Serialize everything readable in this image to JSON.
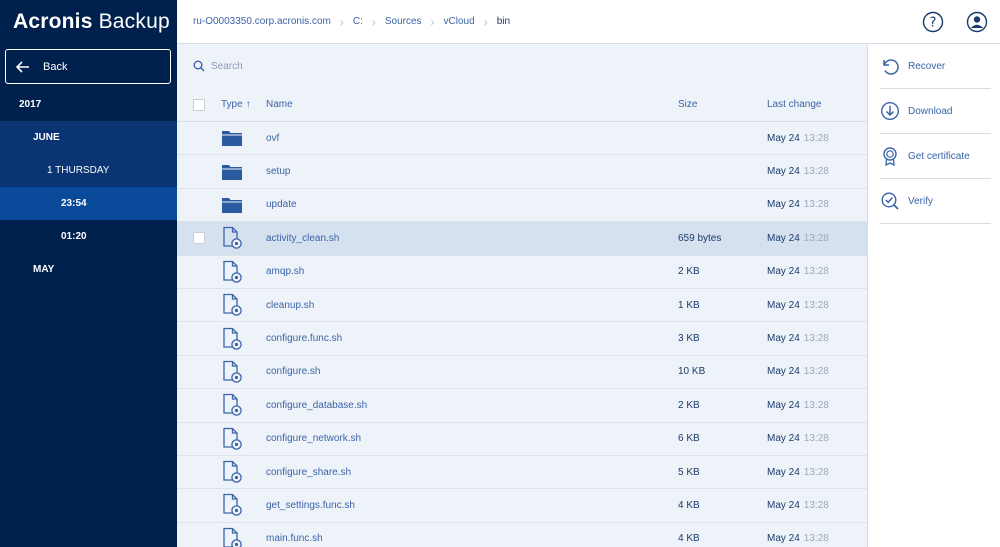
{
  "brand": {
    "name_bold": "Acronis",
    "name_light": "Backup"
  },
  "sidebar": {
    "back_label": "Back",
    "tree": [
      {
        "label": "2017",
        "level": 0,
        "state": "normal"
      },
      {
        "label": "JUNE",
        "level": 1,
        "state": "expanded"
      },
      {
        "label": "1 THURSDAY",
        "level": 2,
        "state": "expanded"
      },
      {
        "label": "23:54",
        "level": 3,
        "state": "selected"
      },
      {
        "label": "01:20",
        "level": 3,
        "state": "normal"
      },
      {
        "label": "MAY",
        "level": 1,
        "state": "normal"
      }
    ]
  },
  "breadcrumb": [
    "ru-O0003350.corp.acronis.com",
    "C:",
    "Sources",
    "vCloud",
    "bin"
  ],
  "topbar_icons": [
    "help-icon",
    "account-icon"
  ],
  "search": {
    "placeholder": "Search"
  },
  "table": {
    "headers": {
      "type": "Type",
      "name": "Name",
      "size": "Size",
      "last_change": "Last change"
    },
    "sort": {
      "column": "type",
      "direction": "ascending"
    },
    "rows": [
      {
        "kind": "folder",
        "name": "ovf",
        "size": "",
        "date": "May 24",
        "time": "13:28"
      },
      {
        "kind": "folder",
        "name": "setup",
        "size": "",
        "date": "May 24",
        "time": "13:28"
      },
      {
        "kind": "folder",
        "name": "update",
        "size": "",
        "date": "May 24",
        "time": "13:28"
      },
      {
        "kind": "file",
        "name": "activity_clean.sh",
        "size": "659 bytes",
        "date": "May 24",
        "time": "13:28",
        "selected": true
      },
      {
        "kind": "file",
        "name": "amqp.sh",
        "size": "2 KB",
        "date": "May 24",
        "time": "13:28"
      },
      {
        "kind": "file",
        "name": "cleanup.sh",
        "size": "1 KB",
        "date": "May 24",
        "time": "13:28"
      },
      {
        "kind": "file",
        "name": "configure.func.sh",
        "size": "3 KB",
        "date": "May 24",
        "time": "13:28"
      },
      {
        "kind": "file",
        "name": "configure.sh",
        "size": "10 KB",
        "date": "May 24",
        "time": "13:28"
      },
      {
        "kind": "file",
        "name": "configure_database.sh",
        "size": "2 KB",
        "date": "May 24",
        "time": "13:28"
      },
      {
        "kind": "file",
        "name": "configure_network.sh",
        "size": "6 KB",
        "date": "May 24",
        "time": "13:28"
      },
      {
        "kind": "file",
        "name": "configure_share.sh",
        "size": "5 KB",
        "date": "May 24",
        "time": "13:28"
      },
      {
        "kind": "file",
        "name": "get_settings.func.sh",
        "size": "4 KB",
        "date": "May 24",
        "time": "13:28"
      },
      {
        "kind": "file",
        "name": "main.func.sh",
        "size": "4 KB",
        "date": "May 24",
        "time": "13:28"
      }
    ]
  },
  "actions": [
    {
      "label": "Recover",
      "icon": "recover-icon"
    },
    {
      "label": "Download",
      "icon": "download-icon"
    },
    {
      "label": "Get certificate",
      "icon": "certificate-icon"
    },
    {
      "label": "Verify",
      "icon": "verify-icon"
    }
  ],
  "colors": {
    "sidebar_bg": "#00204d",
    "selected_tree_bg": "#0a4a9a",
    "accent": "#3b64a7",
    "list_bg": "#eef3f9",
    "selected_row_bg": "#d6e1ef"
  }
}
